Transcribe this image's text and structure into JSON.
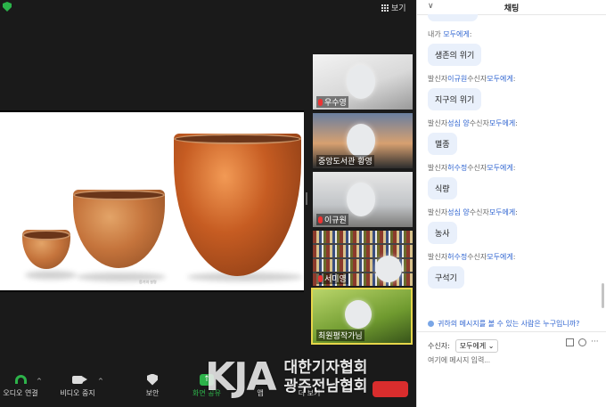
{
  "meeting": {
    "view_label": "보기",
    "share_caption": "웅기의 설명"
  },
  "participants": [
    {
      "name": "우수영"
    },
    {
      "name": "중앙도서관 황영"
    },
    {
      "name": "이규원"
    },
    {
      "name": "서미영"
    },
    {
      "name": "최원평작가님"
    }
  ],
  "toolbar": {
    "audio": "오디오 연결",
    "video": "비디오 중지",
    "security": "보안",
    "share": "화면 공유",
    "apps": "앱",
    "more": "더 보기"
  },
  "watermark": {
    "logo": "KJA",
    "line1": "대한기자협회",
    "line2": "광주전남협회"
  },
  "chat": {
    "title": "채팅",
    "messages": [
      {
        "prefix": "내가 ",
        "from": "",
        "mid": "",
        "to": "모두에게",
        "suffix": ":",
        "text": "생존의 위기"
      },
      {
        "prefix": "발신자",
        "from": "이규원",
        "mid": "수신자",
        "to": "모두에게",
        "suffix": ":",
        "text": "지구의 위기"
      },
      {
        "prefix": "발신자",
        "from": "성심 양",
        "mid": "수신자",
        "to": "모두에게",
        "suffix": ":",
        "text": "멸종"
      },
      {
        "prefix": "발신자",
        "from": "허수정",
        "mid": "수신자",
        "to": "모두에게",
        "suffix": ":",
        "text": "식량"
      },
      {
        "prefix": "발신자",
        "from": "성심 양",
        "mid": "수신자",
        "to": "모두에게",
        "suffix": ":",
        "text": "농사"
      },
      {
        "prefix": "발신자",
        "from": "허수정",
        "mid": "수신자",
        "to": "모두에게",
        "suffix": ":",
        "text": "구석기"
      }
    ],
    "who_can_see": "귀하의 메시지를 볼 수 있는 사람은 누구입니까?",
    "recipient_label": "수신자:",
    "recipient_value": "모두에게",
    "input_placeholder": "여기에 메시지 입력..."
  }
}
